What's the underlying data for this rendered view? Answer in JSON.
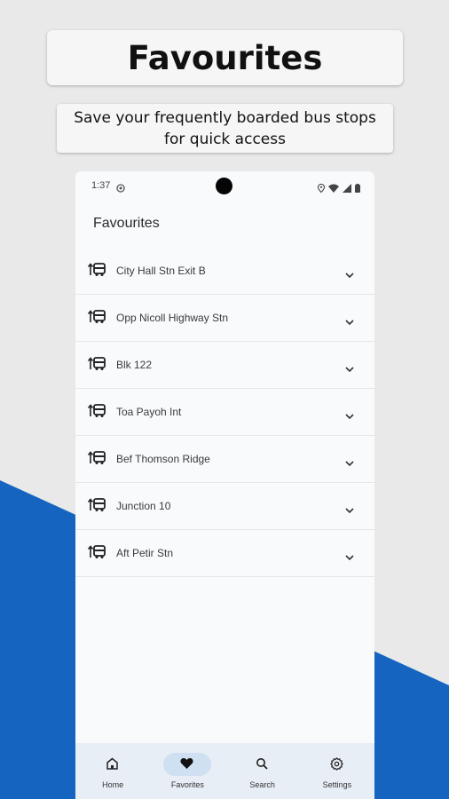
{
  "banner": {
    "title": "Favourites",
    "subtitle": "Save your frequently boarded bus stops for quick access"
  },
  "status_bar": {
    "time": "1:37"
  },
  "page": {
    "title": "Favourites"
  },
  "favourites": [
    {
      "name": "City Hall Stn Exit B",
      "icon": "bus-stop-icon"
    },
    {
      "name": "Opp Nicoll Highway Stn",
      "icon": "bus-stop-icon"
    },
    {
      "name": "Blk 122",
      "icon": "bus-stop-icon"
    },
    {
      "name": "Toa Payoh Int",
      "icon": "bus-stop-icon"
    },
    {
      "name": "Bef Thomson Ridge",
      "icon": "bus-stop-icon"
    },
    {
      "name": "Junction 10",
      "icon": "bus-stop-icon"
    },
    {
      "name": "Aft Petir Stn",
      "icon": "bus-stop-icon"
    }
  ],
  "nav": {
    "home": "Home",
    "favorites": "Favorites",
    "search": "Search",
    "settings": "Settings",
    "active": "favorites"
  },
  "colors": {
    "accent_blue": "#1565c0",
    "active_pill": "#cfe0f2",
    "background": "#e9e9ea"
  }
}
